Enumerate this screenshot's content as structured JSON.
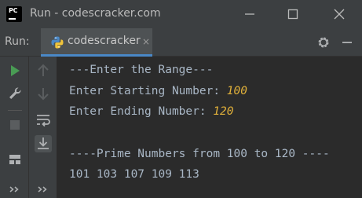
{
  "window": {
    "title": "Run - codescracker.com",
    "app_icon_text": "PC"
  },
  "run_panel": {
    "label": "Run:",
    "tab_label": "codescracker",
    "tab_close": "×"
  },
  "console": {
    "lines": [
      "---Enter the Range---",
      "Enter Starting Number: ",
      "Enter Ending Number: ",
      "",
      "----Prime Numbers from 100 to 120 ----",
      "101 103 107 109 113"
    ],
    "inputs": {
      "start": "100",
      "end": "120"
    }
  },
  "colors": {
    "console_bg": "#2b2b2b",
    "panel_bg": "#3c3f41",
    "text": "#a9b7c6",
    "input_text": "#e0b03a",
    "run_green": "#499c54",
    "tab_accent": "#4a88c7"
  },
  "icons": {
    "minimize": "minimize-icon",
    "maximize": "maximize-icon",
    "close": "close-icon",
    "settings": "gear-icon",
    "hide": "hide-icon",
    "rerun": "play-icon",
    "wrench": "wrench-icon",
    "up": "arrow-up-icon",
    "down": "arrow-down-icon",
    "stop": "stop-icon",
    "soft_wrap": "soft-wrap-icon",
    "scroll_end": "scroll-to-end-icon",
    "layout": "layout-icon",
    "more": "more-icon"
  }
}
